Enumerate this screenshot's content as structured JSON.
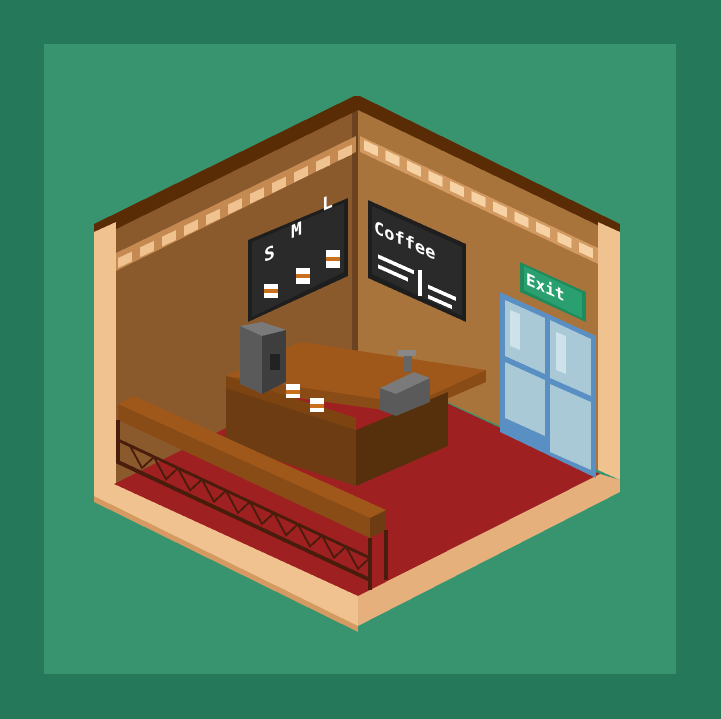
{
  "scene": {
    "name": "isometric-coffee-shop",
    "colors": {
      "frame": "#25785a",
      "panel": "#38946f",
      "wall_left": "#8a5a2c",
      "wall_right": "#a8743c",
      "wall_trim": "#f0c290",
      "roof": "#5a2c06",
      "floor": "#9e2020",
      "counter": "#6e3c12",
      "window_glass": "#a9c9d6",
      "window_frame": "#5a8fc4"
    }
  },
  "menu_board": {
    "sizes": [
      "S",
      "M",
      "L"
    ]
  },
  "coffee_sign": {
    "title": "Coffee"
  },
  "exit_sign": {
    "label": "Exit"
  }
}
